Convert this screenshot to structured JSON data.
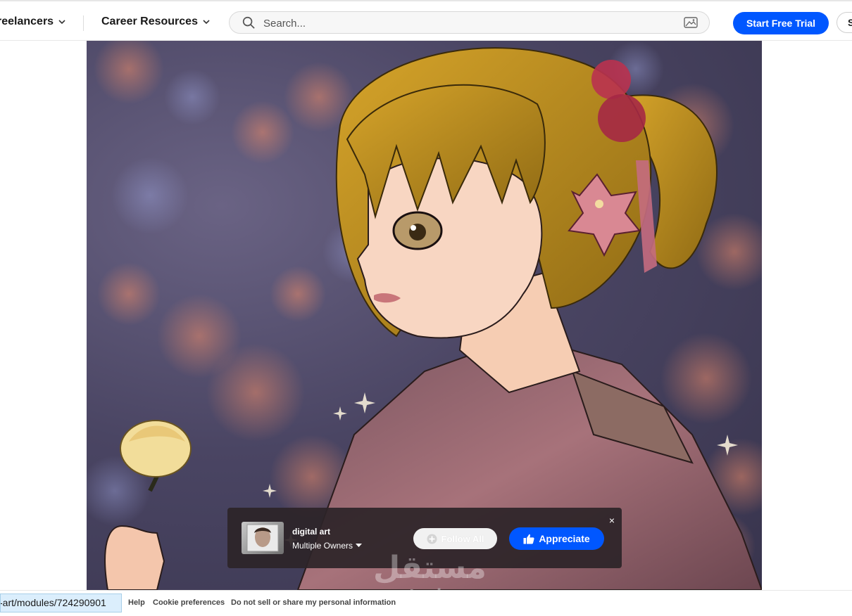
{
  "nav": {
    "freelancers_label": "reelancers",
    "career_label": "Career Resources",
    "search_placeholder": "Search...",
    "trial_label": "Start Free Trial",
    "signin_label": "S"
  },
  "project": {
    "title": "digital art",
    "owners_label": "Multiple Owners",
    "follow_label": "Follow All",
    "appreciate_label": "Appreciate",
    "close_label": "×"
  },
  "watermark": {
    "arabic": "مستقل",
    "latin": "mostaql.com"
  },
  "footer": {
    "status_url": "-art/modules/724290901",
    "help": "Help",
    "cookie": "Cookie preferences",
    "dns": "Do not sell or share my personal information"
  },
  "colors": {
    "brand_blue": "#0057ff",
    "bar_bg": "#2c2428"
  },
  "icons": [
    "chevron-down-icon",
    "search-icon",
    "image-search-icon",
    "plus-circle-icon",
    "thumbs-up-icon",
    "close-icon",
    "caret-down-icon"
  ]
}
